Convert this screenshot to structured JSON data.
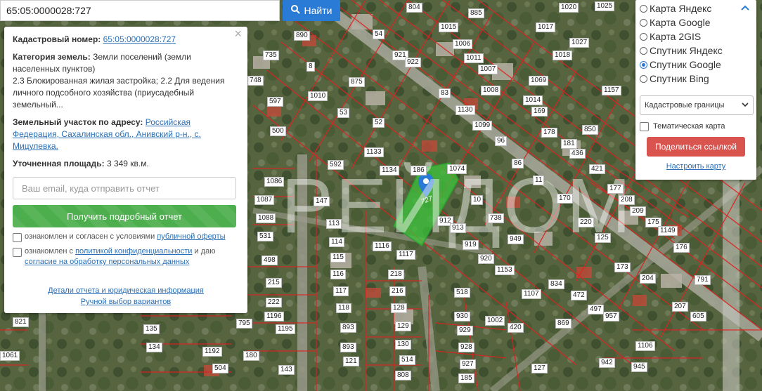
{
  "search": {
    "value": "65:05:0000028:727",
    "button_label": "Найти"
  },
  "info_panel": {
    "cadastral_label": "Кадастровый номер:",
    "cadastral_value": "65:05:0000028:727",
    "category_label": "Категория земель:",
    "category_value": "Земли поселений (земли населенных пунктов)",
    "usage_text": "2.3 Блокированная жилая застройка; 2.2 Для ведения личного подсобного хозяйства (приусадебный земельный...",
    "address_label": "Земельный участок по адресу:",
    "address_value": "Российская Федерация, Сахалинская обл., Анивский р-н., с. Мицулевка.",
    "area_label": "Уточненная площадь:",
    "area_value": "3 349 кв.м.",
    "email_placeholder": "Ваш email, куда отправить отчет",
    "report_button": "Получить подробный отчет",
    "consent1_prefix": "ознакомлен и согласен с условиями",
    "consent1_link": "публичной оферты",
    "consent2_prefix": "ознакомлен с",
    "consent2_link1": "политикой конфиденциальности",
    "consent2_mid": "и даю",
    "consent2_link2": "согласие на обработку персональных данных",
    "details_link": "Детали отчета и юридическая информация",
    "manual_link": "Ручной выбор вариантов",
    "close": "×"
  },
  "layers": {
    "options": [
      {
        "label": "Карта Яндекс",
        "selected": false
      },
      {
        "label": "Карта Google",
        "selected": false
      },
      {
        "label": "Карта 2GIS",
        "selected": false
      },
      {
        "label": "Спутник Яндекс",
        "selected": false
      },
      {
        "label": "Спутник Google",
        "selected": true
      },
      {
        "label": "Спутник Bing",
        "selected": false
      }
    ],
    "select_value": "Кадастровые границы",
    "thematic_label": "Тематическая карта",
    "share_button": "Поделиться ссылкой",
    "setup_link": "Настроить карту"
  },
  "map": {
    "selected_plot_label": "727",
    "watermark": "РЕЙДОМ",
    "plot_labels": [
      "804",
      "885",
      "1020",
      "1025",
      "890",
      "1015",
      "1017",
      "54",
      "1006",
      "1027",
      "735",
      "921",
      "1011",
      "1018",
      "8",
      "922",
      "1007",
      "748",
      "875",
      "83",
      "1008",
      "1069",
      "1157",
      "1010",
      "1014",
      "597",
      "53",
      "1130",
      "169",
      "850",
      "500",
      "52",
      "1099",
      "178",
      "181",
      "96",
      "436",
      "592",
      "1133",
      "186",
      "1074",
      "421",
      "86",
      "1086",
      "1134",
      "11",
      "177",
      "208",
      "1087",
      "147",
      "10",
      "170",
      "209",
      "1088",
      "912",
      "738",
      "220",
      "113",
      "913",
      "125",
      "175",
      "531",
      "114",
      "1116",
      "919",
      "949",
      "1149",
      "498",
      "1117",
      "920",
      "176",
      "115",
      "218",
      "1153",
      "173",
      "215",
      "116",
      "216",
      "518",
      "834",
      "204",
      "791",
      "117",
      "1107",
      "472",
      "207",
      "222",
      "118",
      "128",
      "930",
      "497",
      "1196",
      "1002",
      "957",
      "605",
      "135",
      "1195",
      "129",
      "929",
      "420",
      "869",
      "134",
      "893",
      "130",
      "928",
      "1106",
      "1192",
      "893",
      "927",
      "942",
      "180",
      "121",
      "514",
      "127",
      "945",
      "143",
      "504",
      "1061",
      "821",
      "795",
      "808",
      "185"
    ],
    "colors": {
      "plot_border": "#e02020",
      "selected_fill": "#3cc43c",
      "pin": "#2a7bd6"
    }
  }
}
